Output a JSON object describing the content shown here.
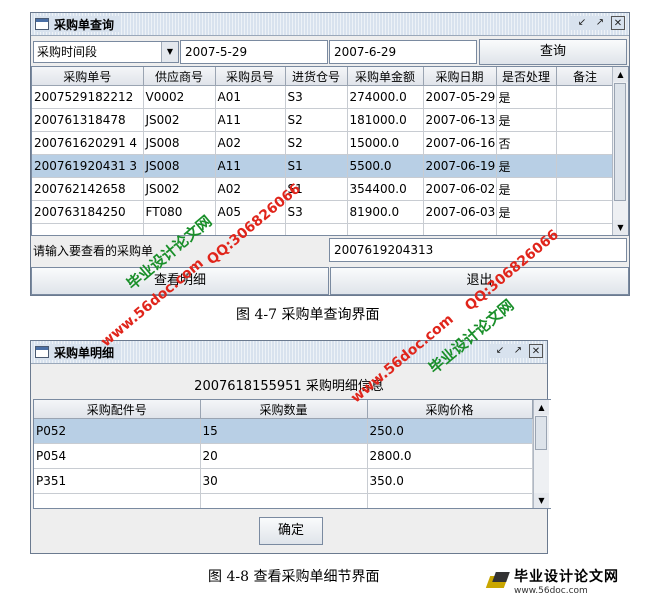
{
  "window1": {
    "title": "采购单查询",
    "combo_value": "采购时间段",
    "start_date": "2007-5-29",
    "end_date": "2007-6-29",
    "query_button": "查询",
    "columns": [
      "采购单号",
      "供应商号",
      "采购员号",
      "进货仓号",
      "采购单金额",
      "采购日期",
      "是否处理",
      "备注"
    ],
    "rows": [
      [
        "2007529182212",
        "V0002",
        "A01",
        "S3",
        "274000.0",
        "2007-05-29",
        "是",
        ""
      ],
      [
        "200761318478",
        "JS002",
        "A11",
        "S2",
        "181000.0",
        "2007-06-13",
        "是",
        ""
      ],
      [
        "200761620291 4",
        "JS008",
        "A02",
        "S2",
        "15000.0",
        "2007-06-16",
        "否",
        ""
      ],
      [
        "200761920431 3",
        "JS008",
        "A11",
        "S1",
        "5500.0",
        "2007-06-19",
        "是",
        ""
      ],
      [
        "200762142658",
        "JS002",
        "A02",
        "S1",
        "354400.0",
        "2007-06-02",
        "是",
        ""
      ],
      [
        "200763184250",
        "FT080",
        "A05",
        "S3",
        "81900.0",
        "2007-06-03",
        "是",
        ""
      ]
    ],
    "prompt_label": "请输入要查看的采购单",
    "order_input": "2007619204313",
    "detail_button": "查看明细",
    "exit_button": "退出"
  },
  "caption1": "图 4-7 采购单查询界面",
  "window2": {
    "title": "采购单明细",
    "header": "2007618155951 采购明细信息",
    "columns": [
      "采购配件号",
      "采购数量",
      "采购价格"
    ],
    "rows": [
      [
        "P052",
        "15",
        "250.0"
      ],
      [
        "P054",
        "20",
        "2800.0"
      ],
      [
        "P351",
        "30",
        "350.0"
      ]
    ],
    "ok_button": "确定"
  },
  "caption2": "图 4-8 查看采购单细节界面",
  "watermarks": {
    "site": "www.56doc.com",
    "qq": "QQ:306826066",
    "brand": "毕业设计论文网"
  },
  "logo": {
    "title": "毕业设计论文网",
    "url": "www.56doc.com"
  }
}
